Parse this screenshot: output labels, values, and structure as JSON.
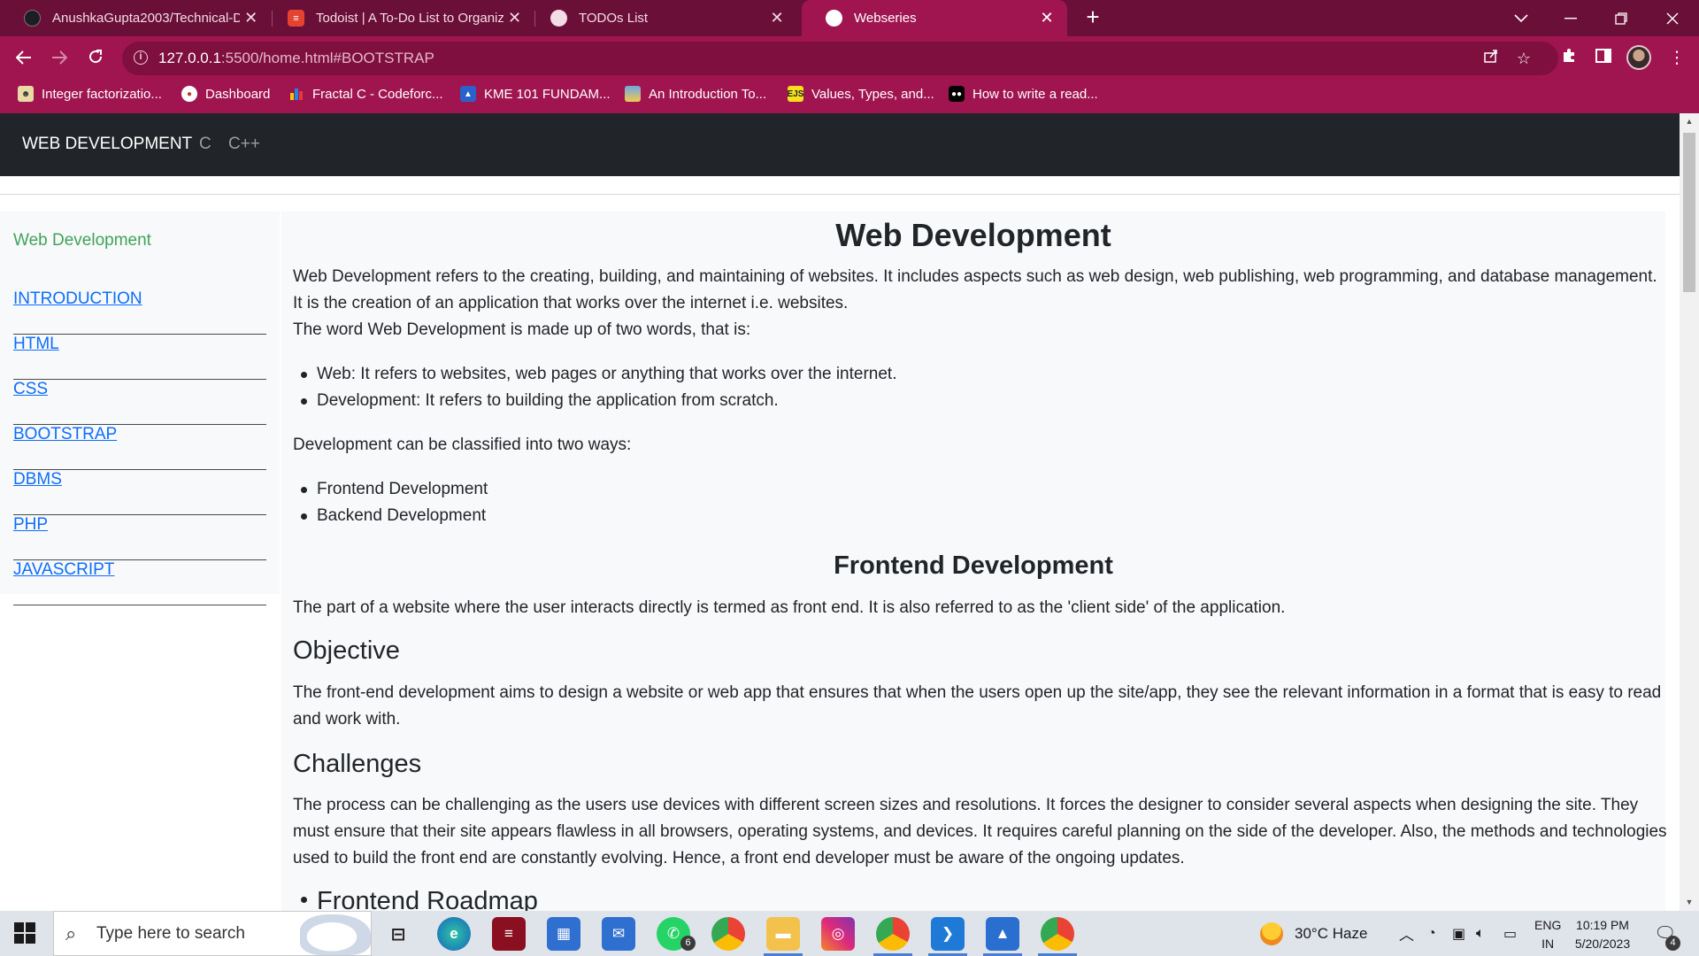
{
  "browser": {
    "tabs": [
      {
        "title": "AnushkaGupta2003/Technical-Do",
        "icon": "github-icon",
        "active": false
      },
      {
        "title": "Todoist | A To-Do List to Organize",
        "icon": "todoist-icon",
        "active": false
      },
      {
        "title": "TODOs List",
        "icon": "globe-icon",
        "active": false
      },
      {
        "title": "Webseries",
        "icon": "globe-icon",
        "active": true
      }
    ],
    "close_glyph": "✕",
    "new_tab_glyph": "+",
    "url_host": "127.0.0.1",
    "url_path": ":5500/home.html#BOOTSTRAP",
    "bookmarks": [
      {
        "label": "Integer factorizatio...",
        "icon": "lego-icon"
      },
      {
        "label": "Dashboard",
        "icon": "codechef-icon"
      },
      {
        "label": "Fractal C - Codeforc...",
        "icon": "codeforces-icon"
      },
      {
        "label": "KME 101 FUNDAM...",
        "icon": "person-icon"
      },
      {
        "label": "An Introduction To...",
        "icon": "image-icon"
      },
      {
        "label": "Values, Types, and...",
        "icon": "ejs-icon",
        "badge_text": "EJS"
      },
      {
        "label": "How to write a read...",
        "icon": "medium-icon"
      }
    ],
    "accent_color": "#a01550",
    "tabstrip_color": "#6a0f38"
  },
  "site": {
    "nav": {
      "brand": "WEB DEVELOPMENT",
      "links": [
        "C",
        "C++"
      ]
    },
    "sidebar": {
      "title": "Web Development",
      "items": [
        "INTRODUCTION",
        "HTML",
        "CSS",
        "BOOTSTRAP",
        "DBMS",
        "PHP",
        "JAVASCRIPT"
      ]
    },
    "main": {
      "title": "Web Development",
      "intro_p1": "Web Development refers to the creating, building, and maintaining of websites. It includes aspects such as web design, web publishing, web programming, and database management. It is the creation of an application that works over the internet i.e. websites.",
      "intro_p2": "The word Web Development is made up of two words, that is:",
      "word_bullets": [
        "Web: It refers to websites, web pages or anything that works over the internet.",
        "Development: It refers to building the application from scratch."
      ],
      "classify_p": "Development can be classified into two ways:",
      "classify_bullets": [
        "Frontend Development",
        "Backend Development"
      ],
      "frontend_heading": "Frontend Development",
      "frontend_p": "The part of a website where the user interacts directly is termed as front end. It is also referred to as the 'client side' of the application.",
      "objective_heading": "Objective",
      "objective_p": "The front-end development aims to design a website or web app that ensures that when the users open up the site/app, they see the relevant information in a format that is easy to read and work with.",
      "challenges_heading": "Challenges",
      "challenges_p": "The process can be challenging as the users use devices with different screen sizes and resolutions. It forces the designer to consider several aspects when designing the site. They must ensure that their site appears flawless in all browsers, operating systems, and devices. It requires careful planning on the side of the developer. Also, the methods and technologies used to build the front end are constantly evolving. Hence, a front end developer must be aware of the ongoing updates.",
      "roadmap_bullet": "Frontend Roadmap"
    }
  },
  "taskbar": {
    "search_placeholder": "Type here to search",
    "whatsapp_badge": "6",
    "weather": "30°C  Haze",
    "lang_top": "ENG",
    "lang_bottom": "IN",
    "time": "10:19 PM",
    "date": "5/20/2023",
    "notifications": "4"
  }
}
